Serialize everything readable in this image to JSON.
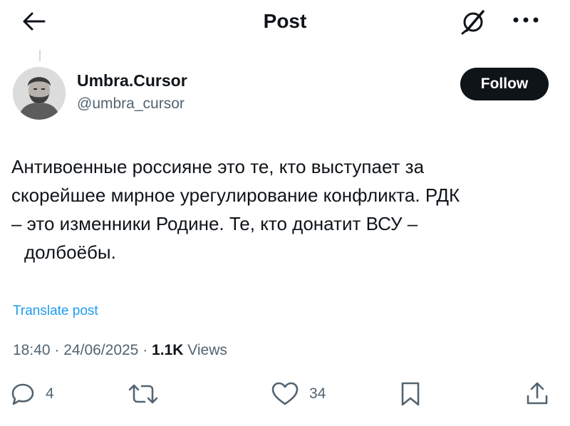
{
  "header": {
    "title": "Post",
    "icons": {
      "back": "back-arrow-icon",
      "grok": "grok-icon",
      "more": "more-icon"
    }
  },
  "author": {
    "display_name": "Umbra.Cursor",
    "handle": "@umbra_cursor",
    "follow_label": "Follow"
  },
  "post": {
    "text_lines": [
      "Антивоенные россияне это те, кто выступает за",
      "скорейшее мирное урегулирование конфликта. РДК",
      "– это изменники Родине. Те, кто донатит ВСУ –",
      "долбоёбы."
    ],
    "translate_label": "Translate post",
    "time": "18:40",
    "date": "24/06/2025",
    "separator": "·",
    "views_count": "1.1K",
    "views_label": "Views"
  },
  "actions": {
    "reply_count": "4",
    "like_count": "34",
    "icons": [
      "reply-icon",
      "repost-icon",
      "like-icon",
      "bookmark-icon",
      "share-icon"
    ]
  },
  "colors": {
    "text": "#0f1419",
    "secondary": "#536471",
    "link": "#1d9bf0",
    "follow_bg": "#0f1419",
    "follow_text": "#ffffff"
  }
}
